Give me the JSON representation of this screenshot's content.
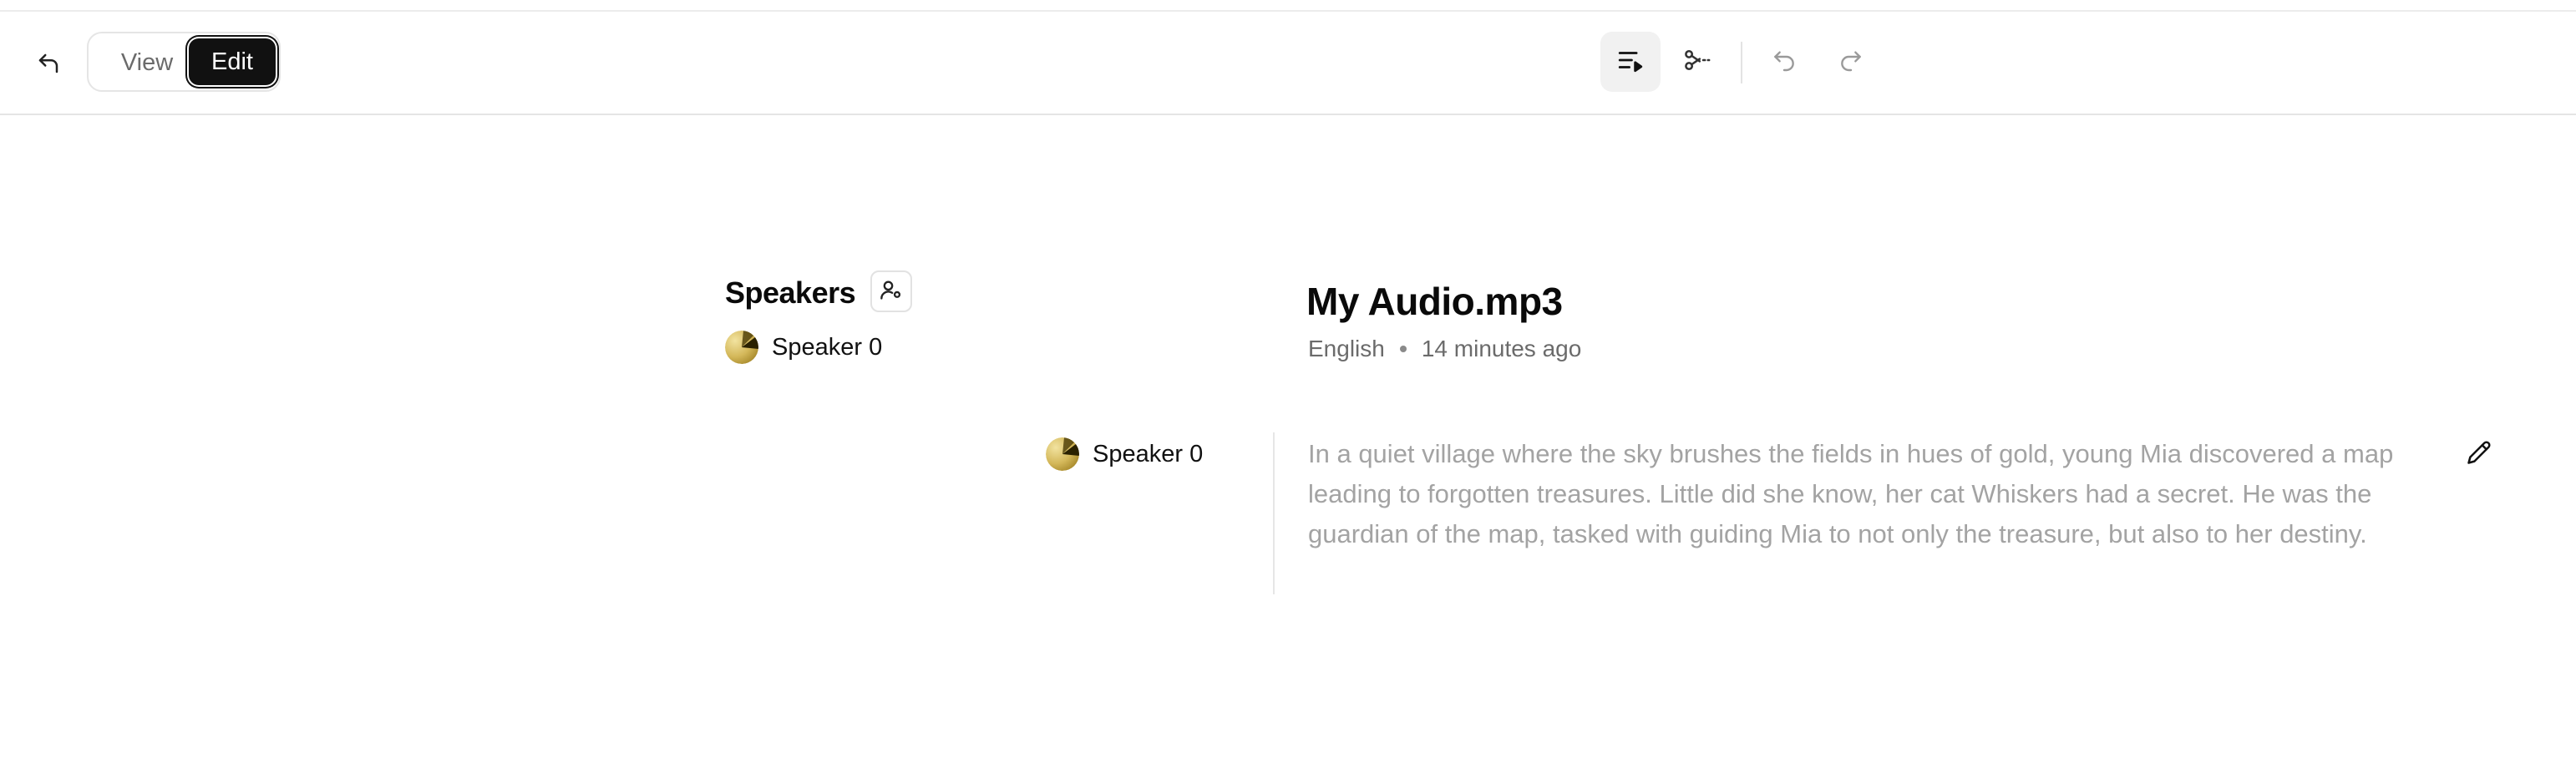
{
  "toolbar": {
    "back_icon": "undo-arrow-icon",
    "view_label": "View",
    "edit_label": "Edit",
    "tools": [
      "playlist-play-icon",
      "scissors-icon",
      "undo-icon",
      "redo-icon"
    ]
  },
  "speakers": {
    "title": "Speakers",
    "manage_icon": "user-settings-icon",
    "items": [
      {
        "name": "Speaker 0"
      }
    ]
  },
  "file": {
    "title": "My Audio.mp3",
    "language": "English",
    "time_ago": "14 minutes ago"
  },
  "segment": {
    "speaker": "Speaker 0",
    "text": "In a quiet village where the sky brushes the fields in hues of gold, young Mia discovered a map leading to forgotten treasures. Little did she know, her cat Whiskers had a secret. He was the guardian of the map, tasked with guiding Mia to not only the treasure, but also to her destiny.",
    "edit_icon": "pencil-icon"
  },
  "colors": {
    "accent": "#111111",
    "muted_text": "#a3a3a3",
    "avatar_gold": "#d4b85a"
  }
}
